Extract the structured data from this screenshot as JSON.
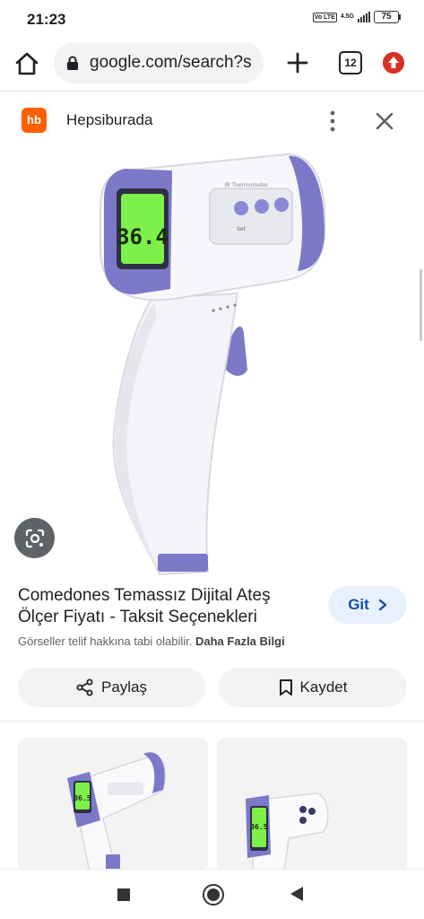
{
  "status_bar": {
    "time": "21:23",
    "volte": "Vo LTE",
    "network": "4.5G",
    "battery": "75"
  },
  "browser": {
    "url": "google.com/search?s",
    "tab_count": "12"
  },
  "panel": {
    "site_logo": "hb",
    "site_name": "Hepsiburada"
  },
  "product": {
    "title": "Comedones Temassız Dijital Ateş Ölçer Fiyatı - Taksit Seçenekleri",
    "visit_label": "Git",
    "notice": "Görseller telif hakkına tabi olabilir.",
    "more_info": "Daha Fazla Bilgi",
    "display_reading": "36.4",
    "device_label": "IR Thermometer",
    "button_label": "Set"
  },
  "actions": {
    "share_label": "Paylaş",
    "save_label": "Kaydet"
  },
  "related": {
    "reading_1": "36.5",
    "reading_2": "36.5"
  },
  "colors": {
    "accent_blue": "#174ea6",
    "chip_blue": "#e8f0fe",
    "hb_orange": "#ff6000",
    "device_purple": "#7b79c8",
    "lcd_green": "#7df04a"
  }
}
